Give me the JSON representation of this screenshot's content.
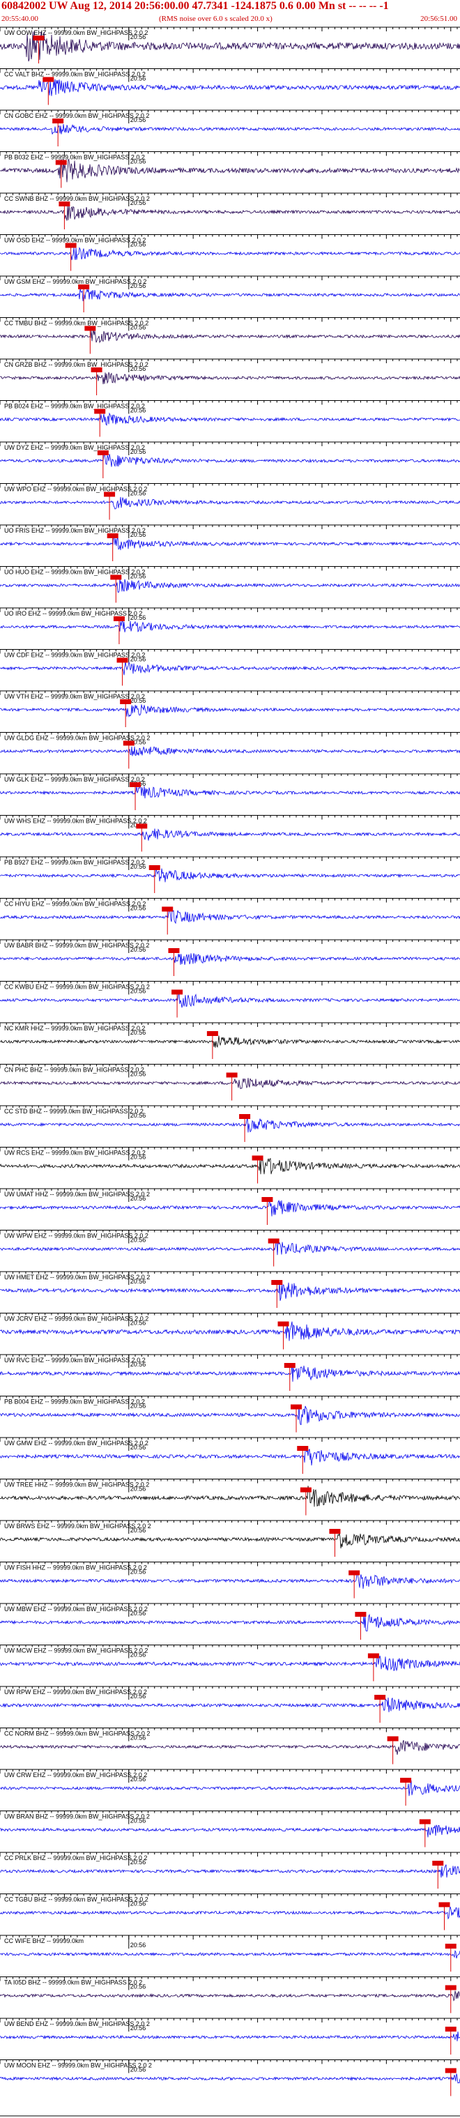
{
  "header": {
    "title": "60842002 UW Aug 12, 2014 20:56:00.00   47.7341 -124.1875  0.6 0.00 Mn st -- -- --   -1",
    "start_time": "20:55:40.00",
    "end_time": "20:56:51.00",
    "rms_note": "(RMS noise over 6.0 s scaled 20.0 x)"
  },
  "colors": {
    "blue": "#0000ee",
    "black": "#000000",
    "purple": "#200050",
    "marker": "#dd0000",
    "label": "#000000"
  },
  "chart_data": {
    "type": "line",
    "title": "60842002 UW Aug 12, 2014 20:56:00.00   47.7341 -124.1875  0.6 0.00 Mn st -- -- --   -1",
    "x_start": "20:55:40.00",
    "x_end": "20:56:51.00",
    "minute_tick_label": "20:56",
    "series": [
      {
        "name": "UW OOW EHZ -- 99999.0km BW_HIGHPASS  2.0  2",
        "color": "purple",
        "amplitude": 0.9,
        "event_sec": 4,
        "pick_sec": 6
      },
      {
        "name": "CC VALT BHZ -- 99999.0km BW_HIGHPASS  2.0  2",
        "color": "blue",
        "amplitude": 0.55,
        "event_sec": 6,
        "pick_sec": 7.5
      },
      {
        "name": "CN GOBC EHZ -- 99999.0km BW_HIGHPASS  2.0  2",
        "color": "blue",
        "amplitude": 0.25,
        "event_sec": 8,
        "pick_sec": 9
      },
      {
        "name": "PB B032 EHZ -- 99999.0km BW_HIGHPASS  2.0  2",
        "color": "purple",
        "amplitude": 0.6,
        "event_sec": 9,
        "pick_sec": 9.5
      },
      {
        "name": "CC SWNB BHZ -- 99999.0km BW_HIGHPASS  2.0  2",
        "color": "purple",
        "amplitude": 0.4,
        "event_sec": 10,
        "pick_sec": 10
      },
      {
        "name": "UW OSD EHZ -- 99999.0km BW_HIGHPASS  2.0  2",
        "color": "blue",
        "amplitude": 0.3,
        "event_sec": 11,
        "pick_sec": 11
      },
      {
        "name": "UW GSM EHZ -- 99999.0km BW_HIGHPASS  2.0  2",
        "color": "blue",
        "amplitude": 0.3,
        "event_sec": 12,
        "pick_sec": 13
      },
      {
        "name": "CC TMBU BHZ -- 99999.0km BW_HIGHPASS  2.0  2",
        "color": "purple",
        "amplitude": 0.3,
        "event_sec": 14,
        "pick_sec": 14
      },
      {
        "name": "CN GRZB BHZ -- 99999.0km BW_HIGHPASS  2.0  2",
        "color": "purple",
        "amplitude": 0.3,
        "event_sec": 15,
        "pick_sec": 15
      },
      {
        "name": "PB B024 EHZ -- 99999.0km BW_HIGHPASS  2.0  2",
        "color": "blue",
        "amplitude": 0.3,
        "event_sec": 15.5,
        "pick_sec": 15.5
      },
      {
        "name": "UW DYZ EHZ -- 99999.0km BW_HIGHPASS  2.0  2",
        "color": "blue",
        "amplitude": 0.35,
        "event_sec": 16,
        "pick_sec": 16
      },
      {
        "name": "UW WPO EHZ -- 99999.0km BW_HIGHPASS  2.0  2",
        "color": "blue",
        "amplitude": 0.3,
        "event_sec": 17,
        "pick_sec": 17
      },
      {
        "name": "UO FRIS EHZ -- 99999.0km BW_HIGHPASS  2.0  2",
        "color": "blue",
        "amplitude": 0.3,
        "event_sec": 17.5,
        "pick_sec": 17.5
      },
      {
        "name": "UO HUO EHZ -- 99999.0km BW_HIGHPASS  2.0  2",
        "color": "blue",
        "amplitude": 0.3,
        "event_sec": 18,
        "pick_sec": 18
      },
      {
        "name": "UO IRO EHZ -- 99999.0km BW_HIGHPASS  2.0  2",
        "color": "blue",
        "amplitude": 0.3,
        "event_sec": 18.5,
        "pick_sec": 18.5
      },
      {
        "name": "UW CDF EHZ -- 99999.0km BW_HIGHPASS  2.0  2",
        "color": "blue",
        "amplitude": 0.3,
        "event_sec": 19,
        "pick_sec": 19
      },
      {
        "name": "UW VTH EHZ -- 99999.0km BW_HIGHPASS  2.0  2",
        "color": "blue",
        "amplitude": 0.3,
        "event_sec": 19.5,
        "pick_sec": 19.5
      },
      {
        "name": "UW GLDG EHZ -- 99999.0km BW_HIGHPASS  2.0  2",
        "color": "blue",
        "amplitude": 0.3,
        "event_sec": 20,
        "pick_sec": 20
      },
      {
        "name": "UW GLK EHZ -- 99999.0km BW_HIGHPASS  2.0  2",
        "color": "blue",
        "amplitude": 0.35,
        "event_sec": 21,
        "pick_sec": 21
      },
      {
        "name": "UW WHS EHZ -- 99999.0km BW_HIGHPASS  2.0  2",
        "color": "blue",
        "amplitude": 0.3,
        "event_sec": 22,
        "pick_sec": 22
      },
      {
        "name": "PB B927 EHZ -- 99999.0km BW_HIGHPASS  2.0  2",
        "color": "blue",
        "amplitude": 0.35,
        "event_sec": 24,
        "pick_sec": 24
      },
      {
        "name": "CC HIYU EHZ -- 99999.0km BW_HIGHPASS  2.0  2",
        "color": "blue",
        "amplitude": 0.35,
        "event_sec": 26,
        "pick_sec": 26
      },
      {
        "name": "UW BABR BHZ -- 99999.0km BW_HIGHPASS  2.0  2",
        "color": "blue",
        "amplitude": 0.35,
        "event_sec": 27,
        "pick_sec": 27
      },
      {
        "name": "CC KWBU EHZ -- 99999.0km BW_HIGHPASS  2.0  2",
        "color": "blue",
        "amplitude": 0.35,
        "event_sec": 27.5,
        "pick_sec": 27.5
      },
      {
        "name": "NC KMR HHZ -- 99999.0km BW_HIGHPASS  2.0  2",
        "color": "black",
        "amplitude": 0.3,
        "event_sec": 33,
        "pick_sec": 33
      },
      {
        "name": "CN PHC BHZ -- 99999.0km BW_HIGHPASS  2.0  2",
        "color": "purple",
        "amplitude": 0.35,
        "event_sec": 36,
        "pick_sec": 36
      },
      {
        "name": "CC STD BHZ -- 99999.0km BW_HIGHPASS  2.0  2",
        "color": "blue",
        "amplitude": 0.35,
        "event_sec": 38,
        "pick_sec": 38
      },
      {
        "name": "UW RCS EHZ -- 99999.0km BW_HIGHPASS  2.0  2",
        "color": "black",
        "amplitude": 0.45,
        "event_sec": 40,
        "pick_sec": 40
      },
      {
        "name": "UW UMAT HHZ -- 99999.0km BW_HIGHPASS  2.0  2",
        "color": "blue",
        "amplitude": 0.4,
        "event_sec": 41.5,
        "pick_sec": 41.5
      },
      {
        "name": "UW WPW EHZ -- 99999.0km BW_HIGHPASS  2.0  2",
        "color": "blue",
        "amplitude": 0.35,
        "event_sec": 42.5,
        "pick_sec": 42.5
      },
      {
        "name": "UW HMET EHZ -- 99999.0km BW_HIGHPASS  2.0  2",
        "color": "blue",
        "amplitude": 0.45,
        "event_sec": 43,
        "pick_sec": 43
      },
      {
        "name": "UW JCRV EHZ -- 99999.0km BW_HIGHPASS  2.0  2",
        "color": "blue",
        "amplitude": 0.55,
        "event_sec": 44,
        "pick_sec": 44
      },
      {
        "name": "UW RVC EHZ -- 99999.0km BW_HIGHPASS  2.0  2",
        "color": "blue",
        "amplitude": 0.45,
        "event_sec": 45,
        "pick_sec": 45
      },
      {
        "name": "PB B004 EHZ -- 99999.0km BW_HIGHPASS  2.0  2",
        "color": "blue",
        "amplitude": 0.45,
        "event_sec": 46,
        "pick_sec": 46
      },
      {
        "name": "UW GMW EHZ -- 99999.0km BW_HIGHPASS  2.0  2",
        "color": "blue",
        "amplitude": 0.45,
        "event_sec": 47,
        "pick_sec": 47
      },
      {
        "name": "UW TREE HHZ -- 99999.0km BW_HIGHPASS  2.0  2",
        "color": "black",
        "amplitude": 0.5,
        "event_sec": 47.5,
        "pick_sec": 47.5
      },
      {
        "name": "UW BRWS EHZ -- 99999.0km BW_HIGHPASS  2.0  2",
        "color": "black",
        "amplitude": 0.45,
        "event_sec": 52,
        "pick_sec": 52
      },
      {
        "name": "UW FISH HHZ -- 99999.0km BW_HIGHPASS  2.0  2",
        "color": "blue",
        "amplitude": 0.4,
        "event_sec": 55,
        "pick_sec": 55
      },
      {
        "name": "UW MBW EHZ -- 99999.0km BW_HIGHPASS  2.0  2",
        "color": "blue",
        "amplitude": 0.4,
        "event_sec": 56,
        "pick_sec": 56
      },
      {
        "name": "UW MCW EHZ -- 99999.0km BW_HIGHPASS  2.0  2",
        "color": "blue",
        "amplitude": 0.45,
        "event_sec": 58,
        "pick_sec": 58
      },
      {
        "name": "UW RPW EHZ -- 99999.0km BW_HIGHPASS  2.0  2",
        "color": "blue",
        "amplitude": 0.4,
        "event_sec": 59,
        "pick_sec": 59
      },
      {
        "name": "CC NORM BHZ -- 99999.0km BW_HIGHPASS  2.0  2",
        "color": "purple",
        "amplitude": 0.35,
        "event_sec": 61,
        "pick_sec": 61
      },
      {
        "name": "UW CRW EHZ -- 99999.0km BW_HIGHPASS  2.0  2",
        "color": "blue",
        "amplitude": 0.35,
        "event_sec": 63,
        "pick_sec": 63
      },
      {
        "name": "UW BRAN BHZ -- 99999.0km BW_HIGHPASS  2.0  2",
        "color": "blue",
        "amplitude": 0.3,
        "event_sec": 66,
        "pick_sec": 66
      },
      {
        "name": "CC PRLK BHZ -- 99999.0km BW_HIGHPASS  2.0  2",
        "color": "blue",
        "amplitude": 0.3,
        "event_sec": 68,
        "pick_sec": 68
      },
      {
        "name": "CC TGBU BHZ -- 99999.0km BW_HIGHPASS  2.0  2",
        "color": "blue",
        "amplitude": 0.25,
        "event_sec": 69,
        "pick_sec": 69
      },
      {
        "name": "CC WIFE BHZ -- 99999.0km",
        "color": "blue",
        "amplitude": 0.15,
        "event_sec": 70,
        "pick_sec": 70
      },
      {
        "name": "TA I05D BHZ -- 99999.0km BW_HIGHPASS  2.0  2",
        "color": "purple",
        "amplitude": 0.25,
        "event_sec": 70,
        "pick_sec": 70
      },
      {
        "name": "UW BEND EHZ -- 99999.0km BW_HIGHPASS  2.0  2",
        "color": "blue",
        "amplitude": 0.25,
        "event_sec": 70,
        "pick_sec": 70
      },
      {
        "name": "UW MOON EHZ -- 99999.0km BW_HIGHPASS  2.0  2",
        "color": "blue",
        "amplitude": 0.25,
        "event_sec": 70,
        "pick_sec": 70
      }
    ]
  }
}
